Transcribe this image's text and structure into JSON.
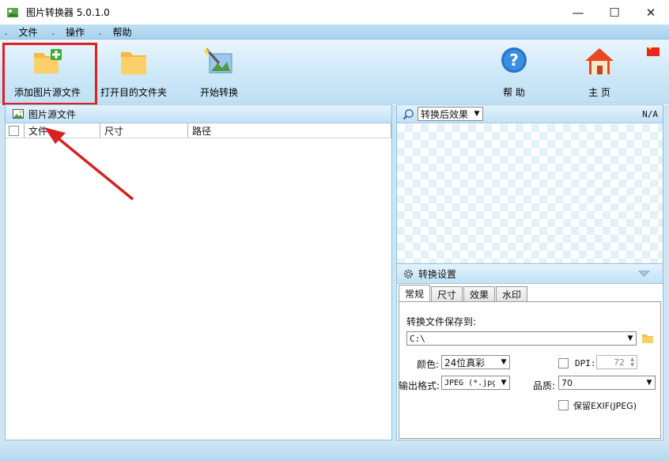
{
  "window": {
    "title": "图片转换器 5.0.1.0",
    "minimize": "—",
    "maximize": "☐",
    "close": "✕"
  },
  "menu": {
    "items": [
      {
        "label": "文件"
      },
      {
        "label": "操作"
      },
      {
        "label": "帮助"
      }
    ]
  },
  "toolbar": {
    "add_source": "添加图片源文件",
    "open_dest": "打开目的文件夹",
    "start": "开始转换",
    "help": "帮 助",
    "home": "主 页"
  },
  "source_panel": {
    "title": "图片源文件",
    "columns": [
      "文件",
      "尺寸",
      "路径"
    ]
  },
  "preview_panel": {
    "dropdown_value": "转换后效果",
    "status": "N/A"
  },
  "settings_panel": {
    "title": "转换设置",
    "tabs": [
      "常规",
      "尺寸",
      "效果",
      "水印"
    ],
    "active_tab": "常规",
    "save_to_label": "转换文件保存到:",
    "save_path": "C:\\",
    "color_label": "颜色:",
    "color_value": "24位真彩",
    "dpi_label": "DPI:",
    "dpi_value": "72",
    "format_label": "输出格式:",
    "format_value": "JPEG (*.jpg",
    "quality_label": "品质:",
    "quality_value": "70",
    "exif_label": "保留EXIF(JPEG)"
  },
  "colors": {
    "highlight": "#e01f1f",
    "accent": "#8cbfe0"
  }
}
